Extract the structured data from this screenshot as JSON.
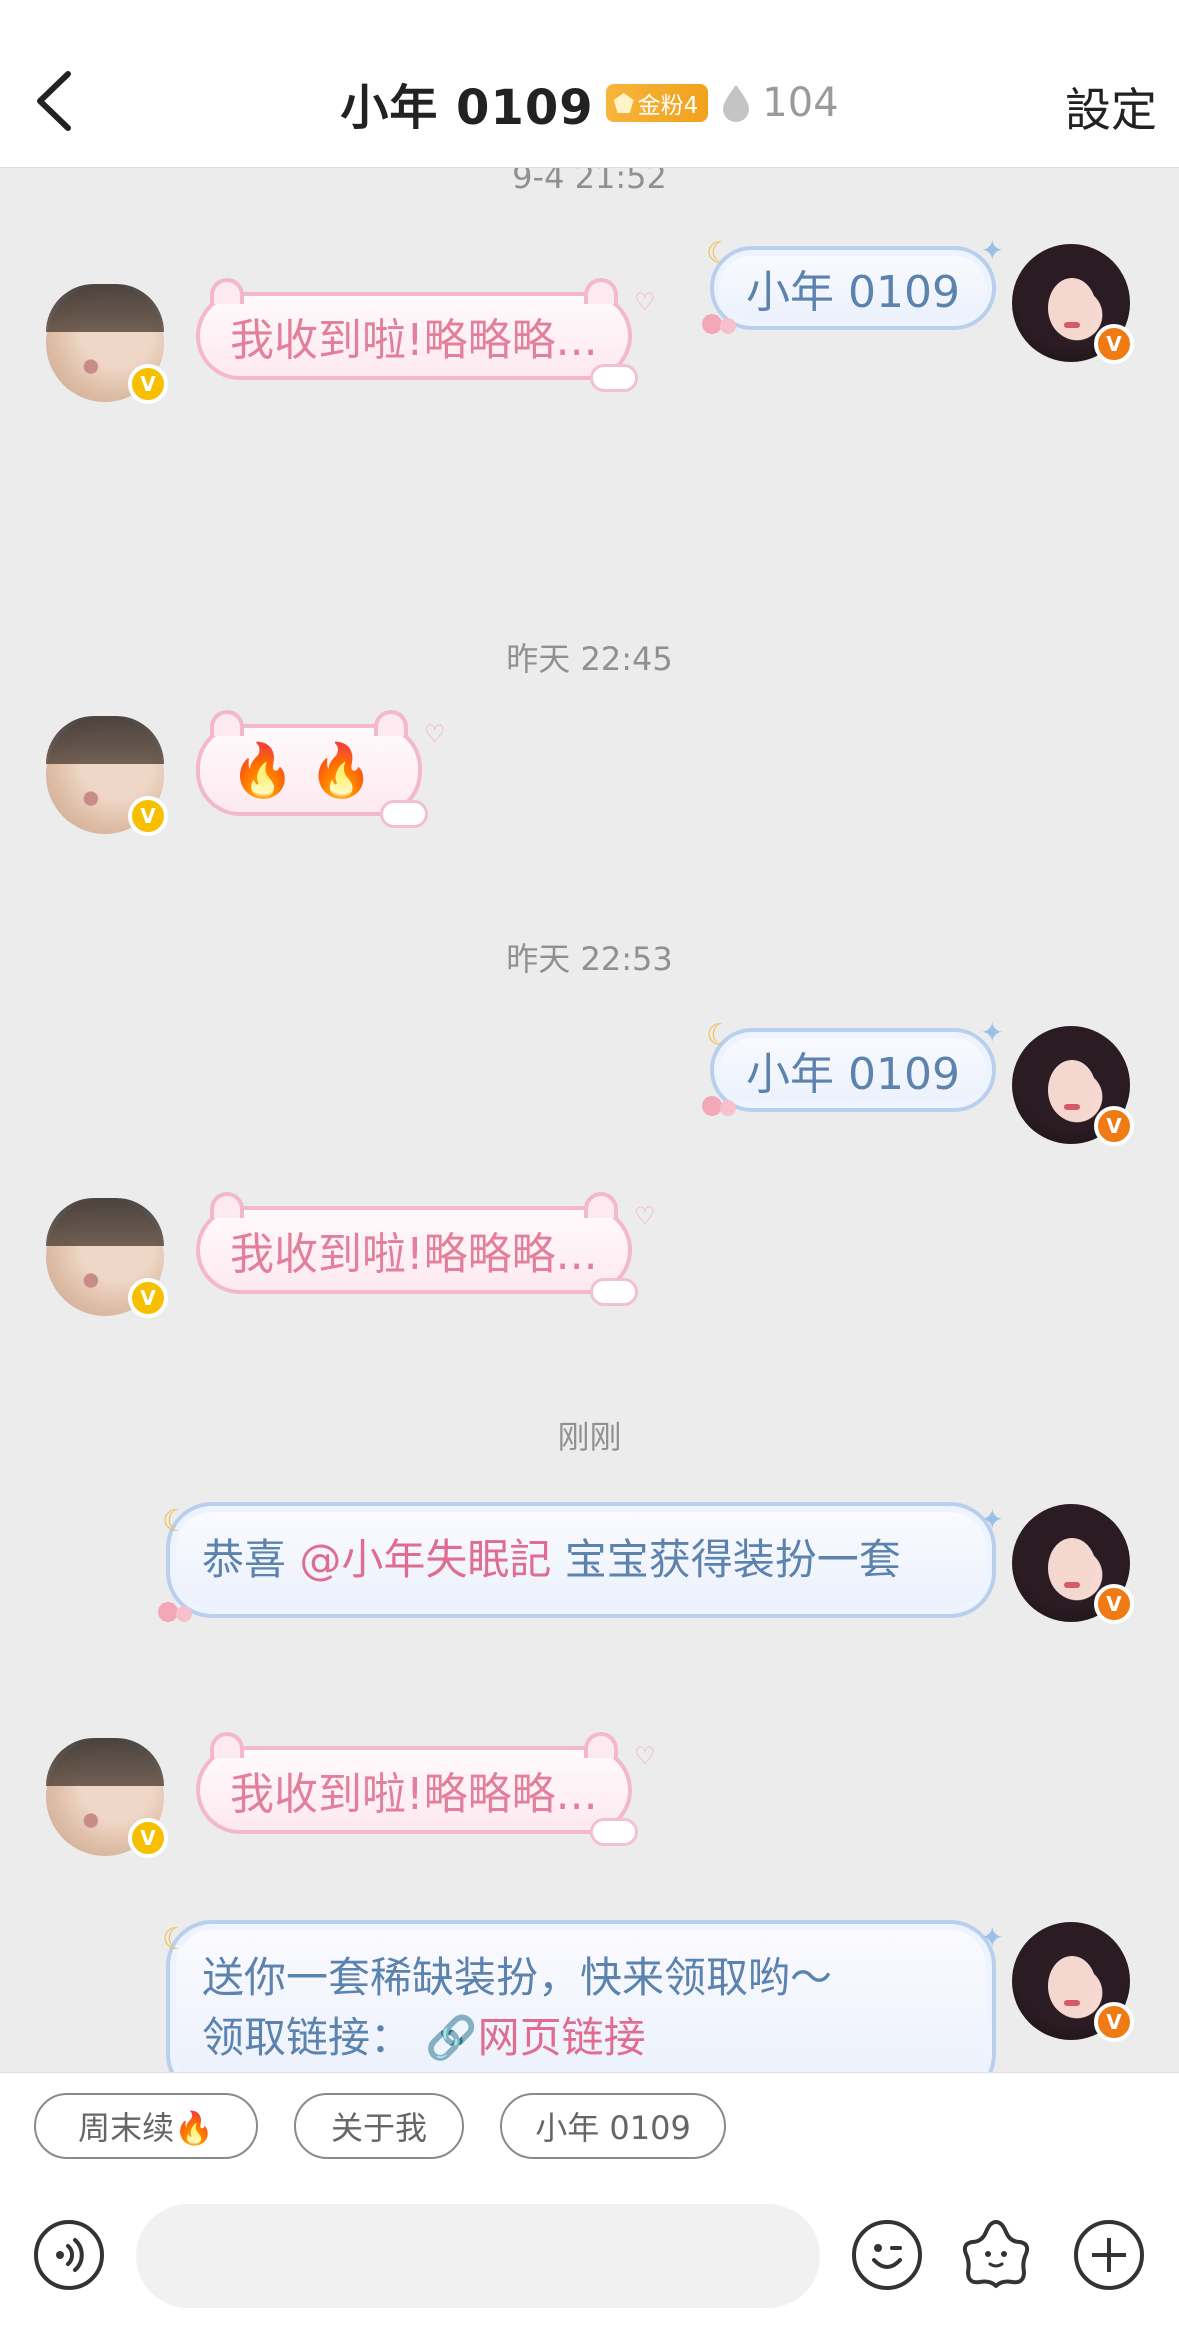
{
  "header": {
    "back_icon": "chevron-left-icon",
    "title": "小年 0109",
    "fan_badge": "金粉4",
    "drop_count": "104",
    "settings": "設定"
  },
  "messages": {
    "ts1": "9-4 21:52",
    "m1": "小年 0109",
    "m2": "我收到啦!略略略...",
    "ts2": "昨天 22:45",
    "m3_flame1": "🔥",
    "m3_flame2": "🔥",
    "ts3": "昨天 22:53",
    "m4": "小年 0109",
    "m5": "我收到啦!略略略...",
    "ts4": "刚刚",
    "m6_pre": "恭喜",
    "m6_mention": "@小年失眠記",
    "m6_post": "宝宝获得装扮一套",
    "m7": "我收到啦!略略略...",
    "m8_line1": "送你一套稀缺装扮，快来领取哟～",
    "m8_line2_label": "领取链接：",
    "m8_link": "网页链接"
  },
  "quick_replies": [
    "周末续🔥",
    "关于我",
    "小年 0109"
  ],
  "input": {
    "placeholder": ""
  },
  "colors": {
    "accent_blue": "#5b83ad",
    "accent_pink": "#e27f9c",
    "verified_yellow": "#f6c000",
    "verified_orange": "#f07a14"
  }
}
